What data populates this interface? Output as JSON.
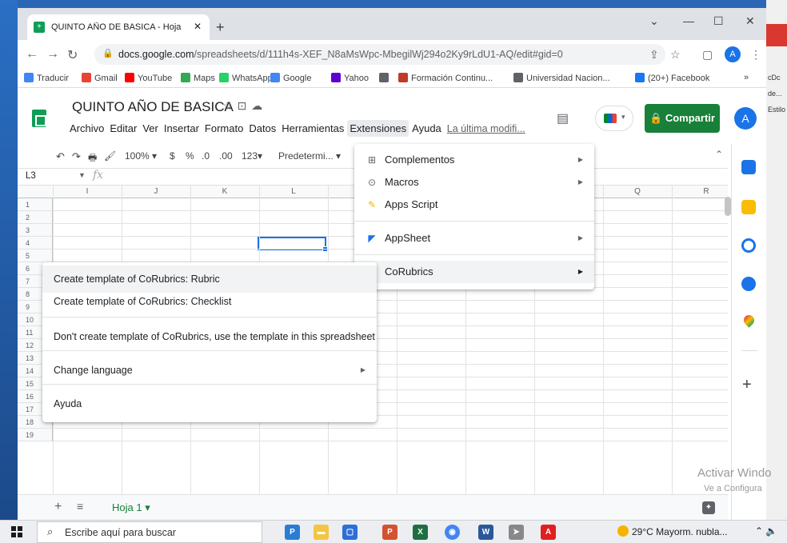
{
  "browser": {
    "tab_title": "QUINTO AÑO DE BASICA - Hoja ",
    "url_host": "docs.google.com",
    "url_path": "/spreadsheets/d/111h4s-XEF_N8aMsWpc-MbegilWj294o2Ky9rLdU1-AQ/edit#gid=0",
    "profile_initial": "A"
  },
  "bookmarks": [
    {
      "label": "Traducir",
      "color": "#4285f4"
    },
    {
      "label": "Gmail",
      "color": "#ea4335"
    },
    {
      "label": "YouTube",
      "color": "#ff0000"
    },
    {
      "label": "Maps",
      "color": "#34a853"
    },
    {
      "label": "WhatsApp",
      "color": "#25d366"
    },
    {
      "label": "Google",
      "color": "#4285f4"
    },
    {
      "label": "Yahoo",
      "color": "#6001d2"
    },
    {
      "label": "",
      "color": "#5f6368"
    },
    {
      "label": "Formación Continu...",
      "color": "#c0392b"
    },
    {
      "label": "Universidad Nacion...",
      "color": "#5f6368"
    },
    {
      "label": "(20+) Facebook",
      "color": "#1877f2"
    }
  ],
  "sheets": {
    "doc_title": "QUINTO AÑO DE BASICA",
    "menus": [
      "Archivo",
      "Editar",
      "Ver",
      "Insertar",
      "Formato",
      "Datos",
      "Herramientas",
      "Extensiones",
      "Ayuda"
    ],
    "last_edit": "La última modifi...",
    "share_label": "Compartir",
    "avatar_initial": "A",
    "zoom": "100%",
    "currency": "$",
    "percent": "%",
    "dec_less": ".0",
    "dec_more": ".00",
    "number_format": "123",
    "font": "Predetermi...",
    "more": "···",
    "name_box": "L3",
    "fx": "fx",
    "columns": [
      "I",
      "J",
      "K",
      "L",
      "",
      "",
      "",
      "",
      "Q",
      "R"
    ],
    "rows": [
      "1",
      "2",
      "3",
      "4",
      "5",
      "6",
      "7",
      "8",
      "9",
      "10",
      "11",
      "12",
      "13",
      "14",
      "15",
      "16",
      "17",
      "18",
      "19"
    ],
    "sheet_tab": "Hoja 1"
  },
  "extensions_menu": [
    {
      "label": "Complementos",
      "icon": "addon-icon",
      "has_submenu": true
    },
    {
      "label": "Macros",
      "icon": "play-circle-icon",
      "has_submenu": true
    },
    {
      "label": "Apps Script",
      "icon": "apps-script-icon",
      "has_submenu": false
    },
    {
      "label": "AppSheet",
      "icon": "appsheet-icon",
      "has_submenu": true
    },
    {
      "label": "CoRubrics",
      "icon": "addon-icon",
      "has_submenu": true
    }
  ],
  "corubrics_menu": [
    "Create template of CoRubrics: Rubric",
    "Create template of CoRubrics: Checklist",
    "Don't create template of CoRubrics, use the template in this spreadsheet",
    "Change language",
    "Ayuda"
  ],
  "watermark": {
    "line1": "Activar Windo",
    "line2": "Ve a Configura"
  },
  "taskbar": {
    "search_placeholder": "Escribe aquí para buscar",
    "weather": "29°C  Mayorm. nubla...",
    "tray": "⌃ 🔈"
  },
  "desktop_right": {
    "a": "cDc",
    "b": "de...",
    "c": "Estilo"
  },
  "accent_colors": {
    "share": "#188038",
    "selection": "#1a73e8"
  }
}
